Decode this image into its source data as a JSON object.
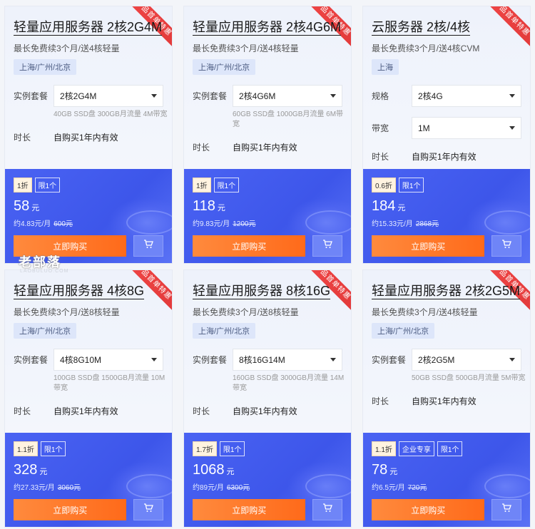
{
  "ribbon_text": "产品首单特惠",
  "duration_label": "时长",
  "duration_value": "自购买1年内有效",
  "buy_label": "立即购买",
  "watermark": "老部落",
  "watermark_sub": "LAOBULUO.COM",
  "cards": [
    {
      "title": "轻量应用服务器 2核2G4M",
      "subtitle": "最长免费续3个月/送4核轻量",
      "region": "上海/广州/北京",
      "fields": [
        {
          "label": "实例套餐",
          "value": "2核2G4M"
        }
      ],
      "desc": "40GB SSD盘 300GB月流量 4M带宽",
      "badges": [
        "1折",
        "限1个"
      ],
      "price": "58",
      "unit": "元",
      "monthly": "约4.83元/月",
      "original": "600元"
    },
    {
      "title": "轻量应用服务器 2核4G6M",
      "subtitle": "最长免费续3个月/送4核轻量",
      "region": "上海/广州/北京",
      "fields": [
        {
          "label": "实例套餐",
          "value": "2核4G6M"
        }
      ],
      "desc": "60GB SSD盘 1000GB月流量 6M带宽",
      "badges": [
        "1折",
        "限1个"
      ],
      "price": "118",
      "unit": "元",
      "monthly": "约9.83元/月",
      "original": "1200元"
    },
    {
      "title": "云服务器 2核/4核",
      "subtitle": "最长免费续3个月/送4核CVM",
      "region": "上海",
      "fields": [
        {
          "label": "规格",
          "value": "2核4G"
        },
        {
          "label": "带宽",
          "value": "1M"
        }
      ],
      "desc": "",
      "badges": [
        "0.6折",
        "限1个"
      ],
      "price": "184",
      "unit": "元",
      "monthly": "约15.33元/月",
      "original": "2868元"
    },
    {
      "title": "轻量应用服务器 4核8G",
      "subtitle": "最长免费续3个月/送8核轻量",
      "region": "上海/广州/北京",
      "fields": [
        {
          "label": "实例套餐",
          "value": "4核8G10M"
        }
      ],
      "desc": "100GB SSD盘 1500GB月流量 10M带宽",
      "badges": [
        "1.1折",
        "限1个"
      ],
      "price": "328",
      "unit": "元",
      "monthly": "约27.33元/月",
      "original": "3060元"
    },
    {
      "title": "轻量应用服务器 8核16G",
      "subtitle": "最长免费续3个月/送8核轻量",
      "region": "上海/广州/北京",
      "fields": [
        {
          "label": "实例套餐",
          "value": "8核16G14M"
        }
      ],
      "desc": "160GB SSD盘 3000GB月流量 14M带宽",
      "badges": [
        "1.7折",
        "限1个"
      ],
      "price": "1068",
      "unit": "元",
      "monthly": "约89元/月",
      "original": "6300元"
    },
    {
      "title": "轻量应用服务器 2核2G5M",
      "subtitle": "最长免费续3个月/送4核轻量",
      "region": "上海/广州/北京",
      "fields": [
        {
          "label": "实例套餐",
          "value": "2核2G5M"
        }
      ],
      "desc": "50GB SSD盘 500GB月流量 5M带宽",
      "badges": [
        "1.1折",
        "企业专享",
        "限1个"
      ],
      "price": "78",
      "unit": "元",
      "monthly": "约6.5元/月",
      "original": "720元"
    }
  ]
}
